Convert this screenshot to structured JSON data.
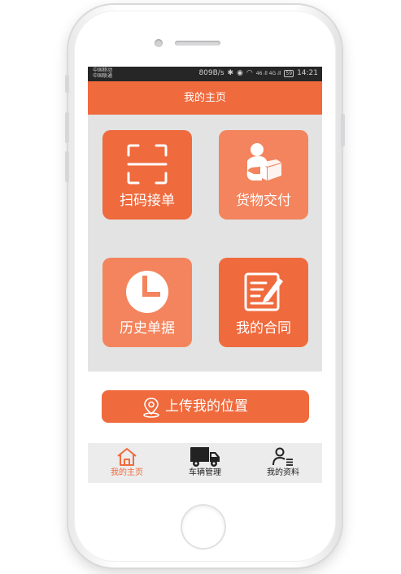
{
  "status_bar": {
    "carrier_1": "中国移动",
    "carrier_2": "中国联通",
    "net_speed": "809B/s",
    "signal": "46 ᵢll 4G ᵢll",
    "battery": "59",
    "time": "14:21"
  },
  "header": {
    "title": "我的主页"
  },
  "tiles": [
    {
      "label": "扫码接单",
      "icon": "scan-icon",
      "color": "#ef6a3d"
    },
    {
      "label": "货物交付",
      "icon": "delivery-icon",
      "color": "#f3845d"
    },
    {
      "label": "历史单据",
      "icon": "clock-icon",
      "color": "#f3845d"
    },
    {
      "label": "我的合同",
      "icon": "contract-icon",
      "color": "#ef6a3d"
    }
  ],
  "location_button": {
    "label": "上传我的位置",
    "icon": "location-pin-icon"
  },
  "tabbar": {
    "items": [
      {
        "label": "我的主页",
        "icon": "home-icon",
        "active": true
      },
      {
        "label": "车辆管理",
        "icon": "truck-icon",
        "active": false
      },
      {
        "label": "我的资料",
        "icon": "profile-icon",
        "active": false
      }
    ]
  },
  "colors": {
    "accent": "#ef6a3d",
    "accent_light": "#f3845d",
    "content_bg": "#e3e3e3"
  }
}
